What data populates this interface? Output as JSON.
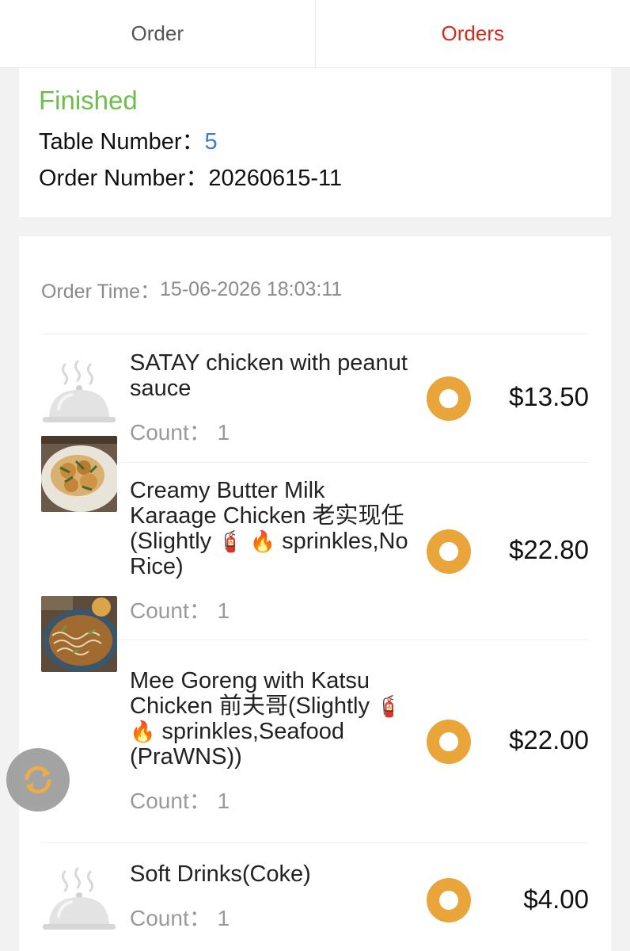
{
  "tabs": [
    {
      "label": "Order",
      "active": false
    },
    {
      "label": "Orders",
      "active": true
    }
  ],
  "summary": {
    "status": "Finished",
    "table_label": "Table Number：",
    "table_value": "5",
    "order_label": "Order Number：",
    "order_value": "20260615-11"
  },
  "order_time": {
    "label": "Order Time：",
    "value": "15-06-2026 18:03:11"
  },
  "items": [
    {
      "name": "SATAY chicken with peanut sauce",
      "count_label": "Count：",
      "count": "1",
      "price": "$13.50",
      "image": "cloche-placeholder-icon"
    },
    {
      "name_prefix": "Creamy Butter Milk Karaage Chicken 老实现任(Slightly ",
      "name_mid": " ",
      "name_suffix": " sprinkles,No Rice)",
      "emoji1": "🧯",
      "emoji2": "🔥",
      "count_label": "Count：",
      "count": "1",
      "price": "$22.80",
      "image": "karaage-chicken-photo"
    },
    {
      "name_prefix": "Mee Goreng with Katsu Chicken 前夫哥(Slightly ",
      "name_mid": " ",
      "name_suffix": " sprinkles,Seafood (PraWNS))",
      "emoji1": "🧯",
      "emoji2": "🔥",
      "count_label": "Count：",
      "count": "1",
      "price": "$22.00",
      "image": "mee-goreng-photo"
    },
    {
      "name": "Soft Drinks(Coke)",
      "count_label": "Count：",
      "count": "1",
      "price": "$4.00",
      "image": "cloche-placeholder-icon"
    }
  ],
  "colors": {
    "accent_red": "#d9291c",
    "status_green": "#6cbf4a",
    "link_blue": "#3a7bd5",
    "dot_orange": "#e9a43a"
  },
  "refresh_button": {
    "icon": "refresh-icon"
  }
}
